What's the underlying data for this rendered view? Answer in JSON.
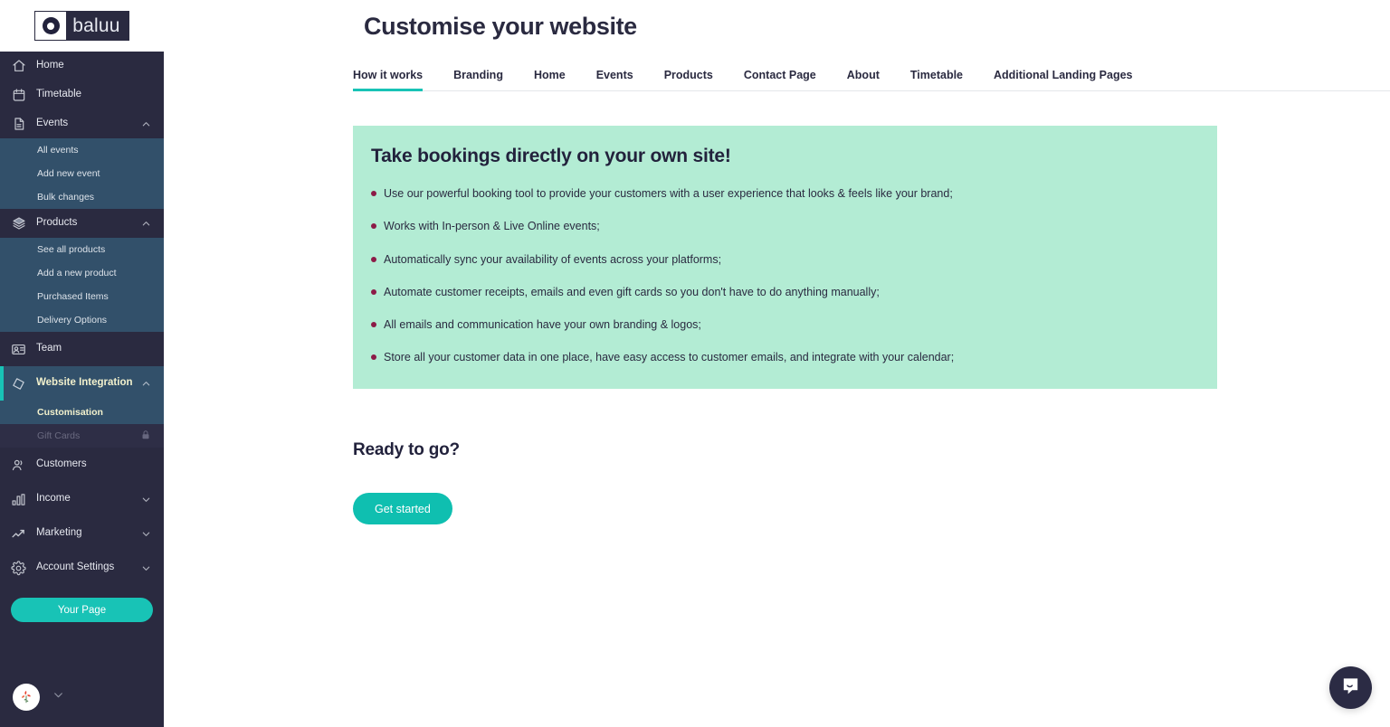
{
  "brand": {
    "logo_text": "baluu",
    "accent_teal": "#18c3b6",
    "sidebar_bg": "#2a2a40",
    "submenu_bg": "#32506a",
    "panel_green": "#b3ecd4",
    "bullet_color": "#8c1b47",
    "highlight_text": "#f2f1cd"
  },
  "sidebar": {
    "items": [
      {
        "label": "Home",
        "icon": "home-icon"
      },
      {
        "label": "Timetable",
        "icon": "calendar-icon"
      },
      {
        "label": "Events",
        "icon": "document-icon",
        "chevron": "chevron-up-icon"
      },
      {
        "label": "Products",
        "icon": "layers-icon",
        "chevron": "chevron-up-icon"
      },
      {
        "label": "Team",
        "icon": "team-icon"
      },
      {
        "label": "Website Integration",
        "icon": "tag-icon",
        "chevron": "chevron-up-icon"
      },
      {
        "label": "Customers",
        "icon": "customers-icon"
      },
      {
        "label": "Income",
        "icon": "bar-chart-icon",
        "chevron": "chevron-down-icon"
      },
      {
        "label": "Marketing",
        "icon": "trend-up-icon",
        "chevron": "chevron-down-icon"
      },
      {
        "label": "Account Settings",
        "icon": "gear-icon",
        "chevron": "chevron-down-icon"
      }
    ],
    "events_submenu": [
      "All events",
      "Add new event",
      "Bulk changes"
    ],
    "products_submenu": [
      "See all products",
      "Add a new product",
      "Purchased Items",
      "Delivery Options"
    ],
    "website_submenu": [
      {
        "label": "Customisation",
        "locked": false
      },
      {
        "label": "Gift Cards",
        "locked": true,
        "icon": "lock-icon"
      }
    ],
    "your_page_button": "Your Page",
    "avatar": "user-avatar",
    "avatar_chevron": "chevron-down-icon"
  },
  "header": {
    "title": "Customise your website"
  },
  "tabs": [
    {
      "label": "How it works",
      "active": true
    },
    {
      "label": "Branding",
      "active": false
    },
    {
      "label": "Home",
      "active": false
    },
    {
      "label": "Events",
      "active": false
    },
    {
      "label": "Products",
      "active": false
    },
    {
      "label": "Contact Page",
      "active": false
    },
    {
      "label": "About",
      "active": false
    },
    {
      "label": "Timetable",
      "active": false
    },
    {
      "label": "Additional Landing Pages",
      "active": false
    }
  ],
  "panel": {
    "heading": "Take bookings directly on your own site!",
    "bullets": [
      "Use our powerful booking tool to provide your customers with a user experience that looks & feels like your brand;",
      "Works with In-person & Live Online events;",
      "Automatically sync your availability of events across your platforms;",
      "Automate customer receipts, emails and even gift cards so you don't have to do anything manually;",
      "All emails and communication have your own branding & logos;",
      "Store all your customer data in one place, have easy access to customer emails, and integrate with your calendar;"
    ]
  },
  "cta": {
    "heading": "Ready to go?",
    "button": "Get started"
  },
  "widgets": {
    "intercom": "chat-bubble-icon"
  }
}
